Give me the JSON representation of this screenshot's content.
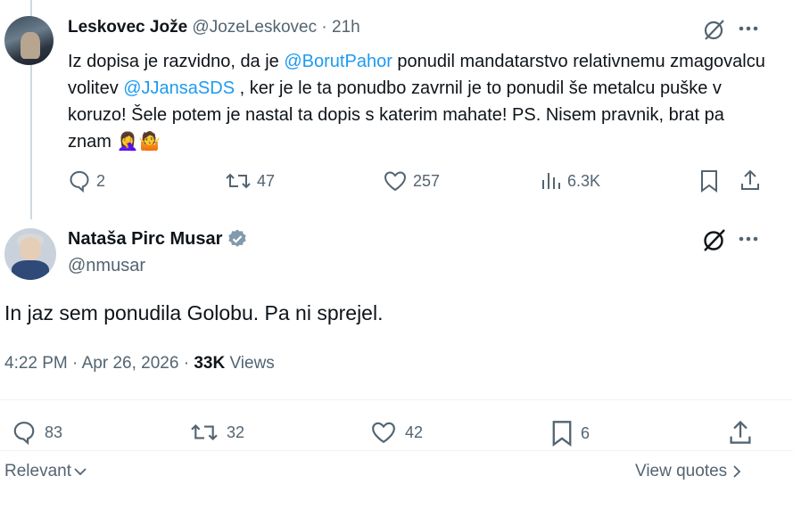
{
  "tweet1": {
    "author_name": "Leskovec Jože",
    "handle": "@JozeLeskovec",
    "separator": " · ",
    "time": "21h",
    "text_parts": {
      "p1": "Iz dopisa je razvidno, da je ",
      "mention1": "@BorutPahor",
      "p2": " ponudil mandatarstvo relativnemu zmagovalcu volitev ",
      "mention2": "@JJansaSDS",
      "p3": " , ker je  le ta ponudbo zavrnil je to ponudil še metalcu puške v koruzo! Šele potem je nastal ta dopis s katerim mahate! PS. Nisem pravnik, brat pa znam ",
      "emoji": "🤦‍♀️🤷"
    },
    "replies": "2",
    "reposts": "47",
    "likes": "257",
    "views": "6.3K"
  },
  "tweet2": {
    "author_name": "Nataša Pirc Musar",
    "handle": "@nmusar",
    "text": "In jaz sem ponudila Golobu. Pa ni sprejel.",
    "time": "4:22 PM",
    "dot": " · ",
    "date": "Apr 26, 2026",
    "views_count": "33K",
    "views_label": " Views",
    "replies": "83",
    "reposts": "32",
    "likes": "42",
    "bookmarks": "6"
  },
  "footer": {
    "sort_label": "Relevant",
    "view_quotes": "View quotes"
  },
  "colors": {
    "accent": "#1d9bf0",
    "muted": "#536471",
    "verified": "#829aab"
  }
}
